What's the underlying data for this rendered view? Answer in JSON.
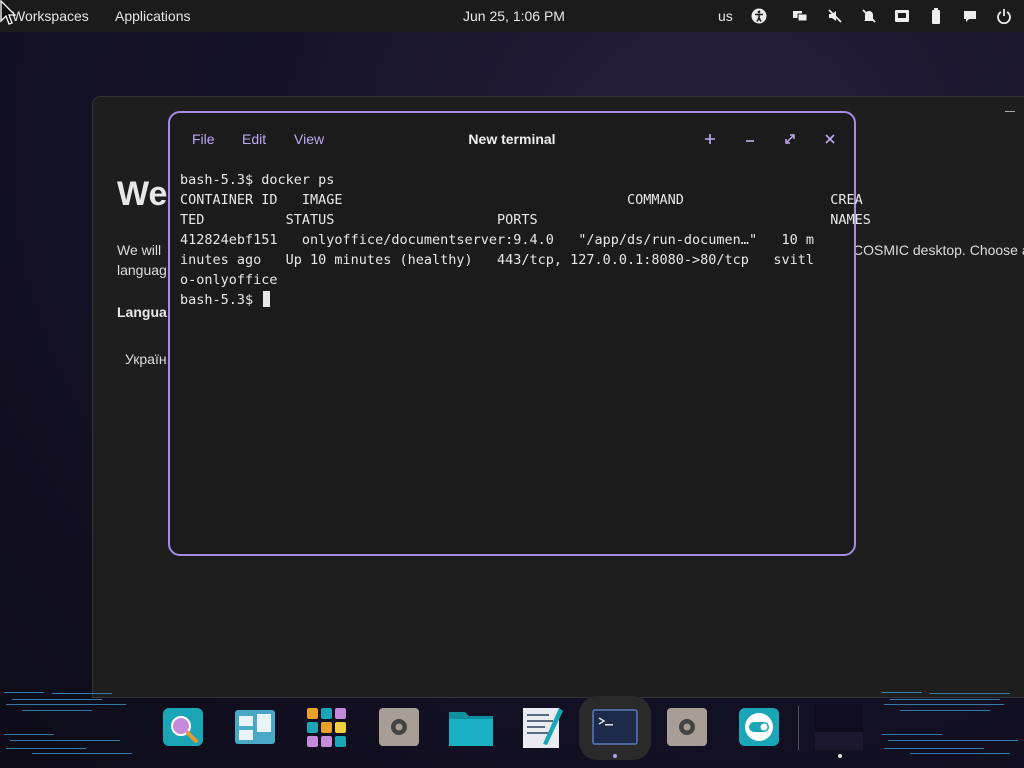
{
  "topbar": {
    "workspaces": "Workspaces",
    "applications": "Applications",
    "clock": "Jun 25, 1:06 PM",
    "keyboard_layout": "us",
    "tray_icons": [
      "accessibility-icon",
      "display-icon",
      "mute-icon",
      "notifications-off-icon",
      "network-icon",
      "battery-icon",
      "chat-icon",
      "power-icon"
    ]
  },
  "background_window": {
    "title_fragment": "We",
    "text_line1_left": "We will",
    "text_line1_right": "COSMIC desktop. Choose a",
    "text_line2": "languag",
    "section_label": "Langua",
    "language_option": "Україн"
  },
  "terminal": {
    "menu": {
      "file": "File",
      "edit": "Edit",
      "view": "View"
    },
    "title": "New terminal",
    "lines": [
      "bash-5.3$ docker ps",
      "CONTAINER ID   IMAGE                                   COMMAND                  CREA",
      "TED          STATUS                    PORTS                                    NAMES",
      "412824ebf151   onlyoffice/documentserver:9.4.0   \"/app/ds/run-documen…\"   10 m",
      "inutes ago   Up 10 minutes (healthy)   443/tcp, 127.0.0.1:8080->80/tcp   svitl",
      "o-onlyoffice"
    ],
    "prompt": "bash-5.3$ "
  },
  "dock": {
    "items": [
      "search-app",
      "workspaces-app",
      "app-library",
      "settings-app",
      "files-app",
      "text-editor-app",
      "terminal-app",
      "settings-app-2",
      "tweaks-app",
      "desktop-preview"
    ]
  },
  "colors": {
    "accent": "#a48ce6",
    "panel": "#1b1b1b",
    "terminal_bg": "#1b1b1b"
  }
}
